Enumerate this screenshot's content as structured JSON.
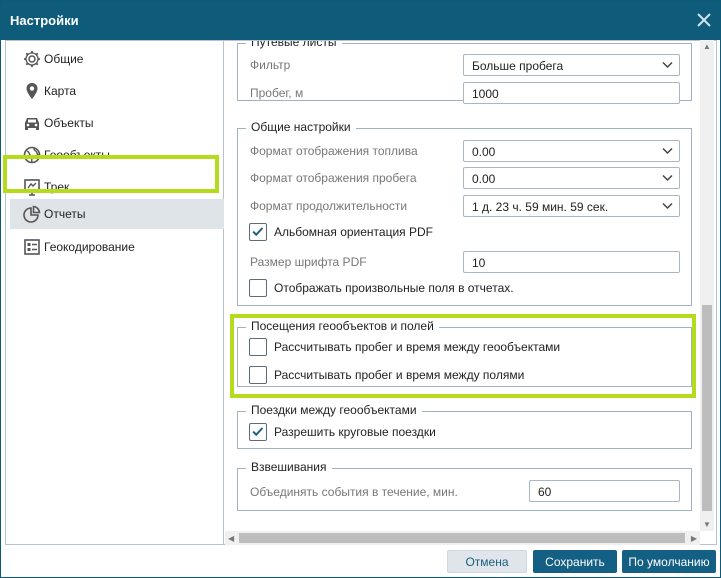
{
  "window": {
    "title": "Настройки"
  },
  "sidebar": {
    "items": [
      {
        "label": "Общие",
        "icon": "gear-icon"
      },
      {
        "label": "Карта",
        "icon": "map-pin-icon"
      },
      {
        "label": "Объекты",
        "icon": "car-icon"
      },
      {
        "label": "Геообъекты",
        "icon": "globe-icon"
      },
      {
        "label": "Трек",
        "icon": "track-icon"
      },
      {
        "label": "Отчеты",
        "icon": "pie-chart-icon"
      },
      {
        "label": "Геокодирование",
        "icon": "geocoding-icon"
      }
    ],
    "active_index": 5
  },
  "waybills": {
    "legend": "Путевые листы",
    "filter_label": "Фильтр",
    "filter_value": "Больше пробега",
    "mileage_label": "Пробег, м",
    "mileage_value": "1000"
  },
  "general": {
    "legend": "Общие настройки",
    "fuel_format_label": "Формат отображения топлива",
    "fuel_format_value": "0.00",
    "mileage_format_label": "Формат отображения пробега",
    "mileage_format_value": "0.00",
    "duration_format_label": "Формат продолжительности",
    "duration_format_value": "1 д. 23 ч. 59 мин. 59 сек.",
    "landscape_label": "Альбомная ориентация PDF",
    "landscape_checked": true,
    "font_size_label": "Размер шрифта PDF",
    "font_size_value": "10",
    "custom_fields_label": "Отображать произвольные поля в отчетах.",
    "custom_fields_checked": false
  },
  "visits": {
    "legend": "Посещения геообъектов и полей",
    "between_geo_label": "Рассчитывать пробег и время между геообъектами",
    "between_geo_checked": false,
    "between_fields_label": "Рассчитывать пробег и время между полями",
    "between_fields_checked": false
  },
  "trips": {
    "legend": "Поездки между геообъектами",
    "round_trips_label": "Разрешить круговые поездки",
    "round_trips_checked": true
  },
  "weighing": {
    "legend": "Взвешивания",
    "merge_label": "Объединять события в течение, мин.",
    "merge_value": "60"
  },
  "footer": {
    "cancel": "Отмена",
    "save": "Сохранить",
    "default": "По умолчанию"
  },
  "colors": {
    "titlebar": "#0f5b7a",
    "highlight": "#b5dc1c",
    "primary_button": "#145f84"
  }
}
